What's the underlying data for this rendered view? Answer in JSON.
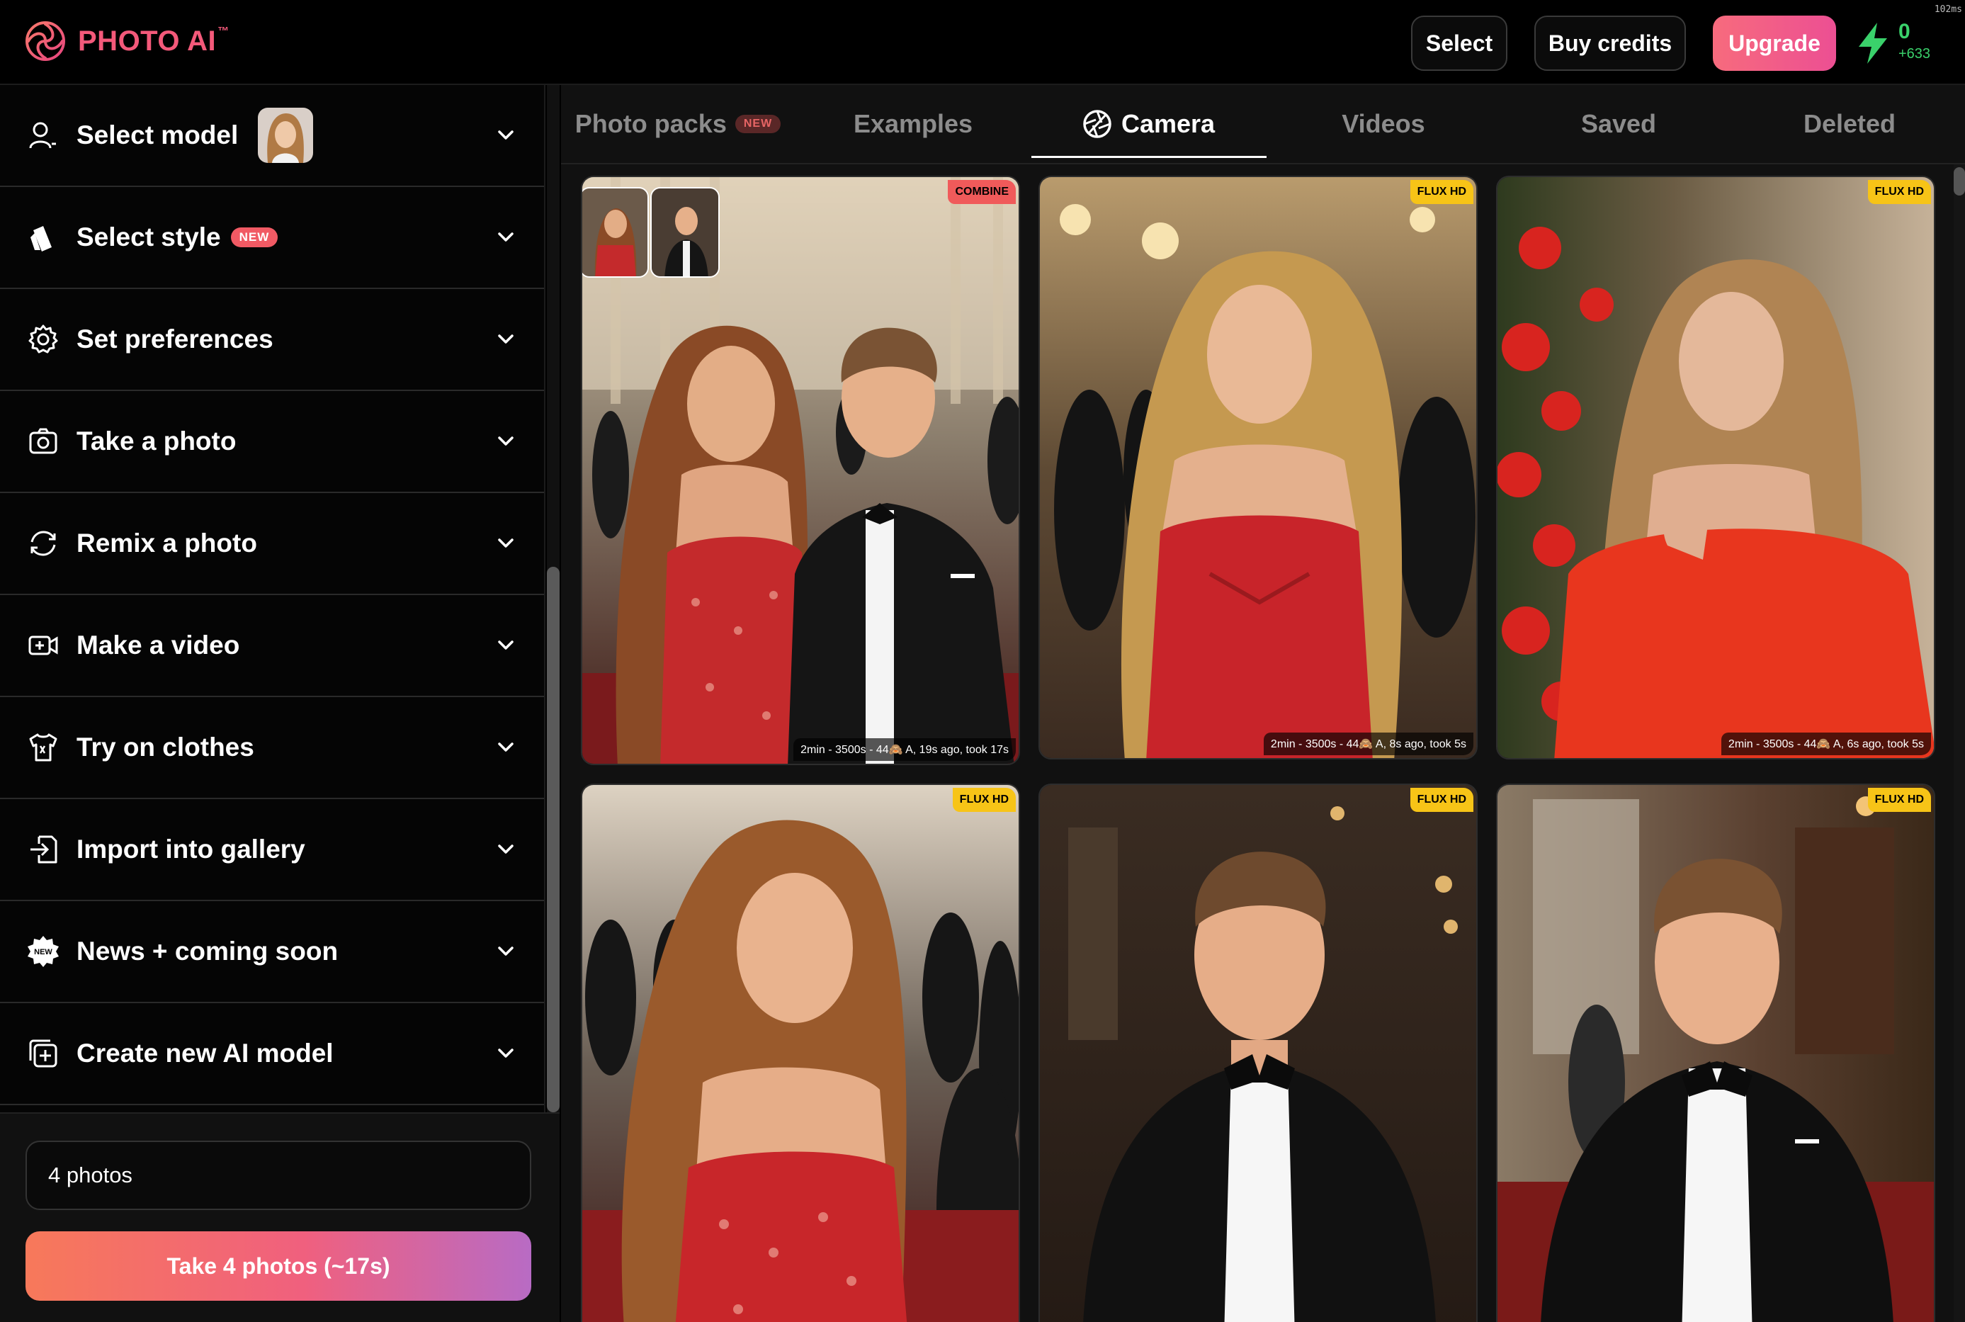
{
  "app": {
    "brand": "PHOTO AI",
    "trademark": "™",
    "debug_ms": "102ms"
  },
  "header": {
    "select_label": "Select",
    "buy_credits_label": "Buy credits",
    "upgrade_label": "Upgrade",
    "credits": "0",
    "credits_delta": "+633"
  },
  "sidebar": {
    "items": [
      {
        "label": "Select model",
        "icon": "user-icon"
      },
      {
        "label": "Select style",
        "icon": "style-icon",
        "badge": "NEW"
      },
      {
        "label": "Set preferences",
        "icon": "gear-icon"
      },
      {
        "label": "Take a photo",
        "icon": "camera-icon"
      },
      {
        "label": "Remix a photo",
        "icon": "remix-icon"
      },
      {
        "label": "Make a video",
        "icon": "video-icon"
      },
      {
        "label": "Try on clothes",
        "icon": "shirt-icon"
      },
      {
        "label": "Import into gallery",
        "icon": "import-icon"
      },
      {
        "label": "News + coming soon",
        "icon": "new-badge-icon",
        "icon_text": "NEW"
      },
      {
        "label": "Create new AI model",
        "icon": "add-model-icon"
      }
    ],
    "photos_count_value": "4 photos",
    "take_button_label": "Take 4 photos (~17s)"
  },
  "tabs": {
    "items": [
      {
        "label": "Photo packs",
        "badge": "NEW"
      },
      {
        "label": "Examples"
      },
      {
        "label": "Camera",
        "active": true
      },
      {
        "label": "Videos"
      },
      {
        "label": "Saved"
      },
      {
        "label": "Deleted"
      }
    ]
  },
  "gallery": {
    "cards": [
      {
        "tag": "COMBINE",
        "caption": "2min - 3500s - 44🙈 A, 19s ago, took 17s"
      },
      {
        "tag": "FLUX HD",
        "caption": "2min - 3500s - 44🙈 A, 8s ago, took 5s"
      },
      {
        "tag": "FLUX HD",
        "caption": "2min - 3500s - 44🙈 A, 6s ago, took 5s"
      },
      {
        "tag": "FLUX HD",
        "caption": ""
      },
      {
        "tag": "FLUX HD",
        "caption": ""
      },
      {
        "tag": "FLUX HD",
        "caption": ""
      }
    ]
  },
  "colors": {
    "brand_pink": "#f3597a",
    "upgrade_gradient": [
      "#f76b7d",
      "#ec4f93"
    ],
    "credits_green": "#3ad16b",
    "flux_yellow": "#f7c417",
    "combine_red": "#f05a5a"
  }
}
